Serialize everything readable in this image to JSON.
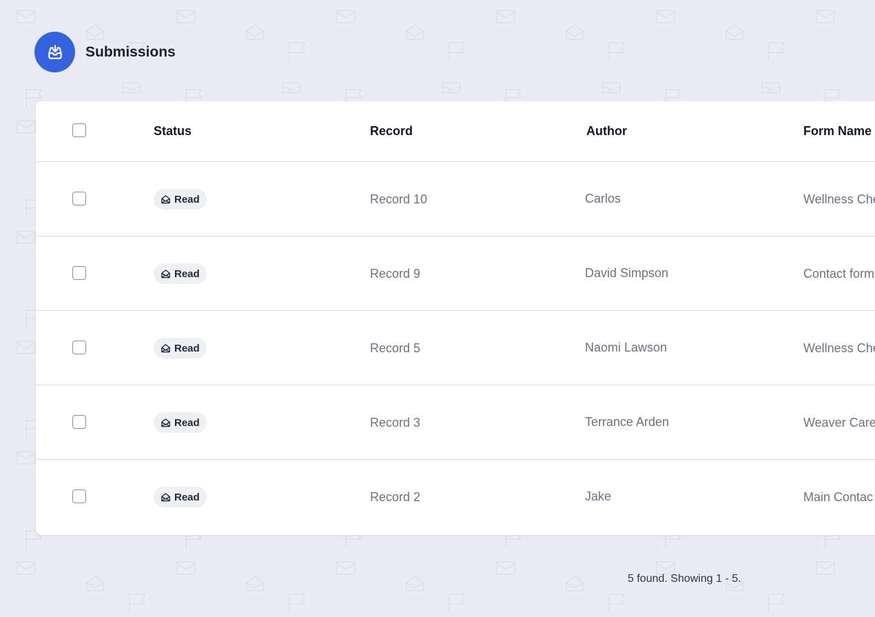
{
  "header": {
    "title": "Submissions",
    "icon": "inbox-download-icon",
    "accent": "#3563e0"
  },
  "table": {
    "columns": [
      "Status",
      "Record",
      "Author",
      "Form Name"
    ],
    "rows": [
      {
        "status": "Read",
        "record": "Record 10",
        "author": "Carlos",
        "form": "Wellness Che"
      },
      {
        "status": "Read",
        "record": "Record 9",
        "author": "David Simpson",
        "form": "Contact form"
      },
      {
        "status": "Read",
        "record": "Record 5",
        "author": "Naomi Lawson",
        "form": "Wellness Che"
      },
      {
        "status": "Read",
        "record": "Record 3",
        "author": "Terrance Arden",
        "form": "Weaver Care"
      },
      {
        "status": "Read",
        "record": "Record 2",
        "author": "Jake",
        "form": "Main Contac"
      }
    ]
  },
  "footer": {
    "summary": "5 found. Showing 1 - 5."
  }
}
